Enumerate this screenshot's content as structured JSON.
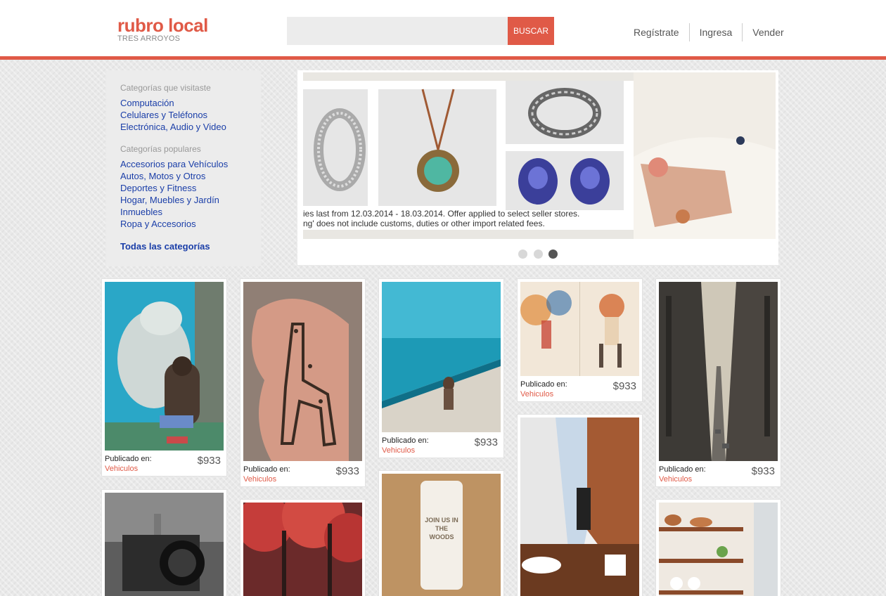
{
  "brand": {
    "title": "rubro local",
    "subtitle": "TRES ARROYOS",
    "accent": "#e05a47"
  },
  "search": {
    "placeholder": "",
    "button_label": "BUSCAR"
  },
  "nav": [
    {
      "label": "Regístrate"
    },
    {
      "label": "Ingresa"
    },
    {
      "label": "Vender"
    }
  ],
  "sidebar": {
    "visited_heading": "Categorías que visitaste",
    "visited": [
      "Computación",
      "Celulares y Teléfonos",
      "Electrónica, Audio y Video"
    ],
    "popular_heading": "Categorías populares",
    "popular": [
      "Accesorios para Vehículos",
      "Autos, Motos y Otros",
      "Deportes y Fitness",
      "Hogar, Muebles y Jardín",
      "Inmuebles",
      "Ropa y Accesorios"
    ],
    "all_label": "Todas las categorías"
  },
  "carousel": {
    "banner_line1": "ies last from 12.03.2014 - 18.03.2014. Offer applied to select seller stores.",
    "banner_line2": "ng' does not include customs, duties or other import related fees.",
    "slides": 3,
    "active_slide": 3
  },
  "products": [
    {
      "image": "polar-bear-image",
      "published_label": "Publicado en:",
      "category": "Vehiculos",
      "price": "$933"
    },
    {
      "image": "giraffe-hand-image",
      "published_label": "Publicado en:",
      "category": "Vehiculos",
      "price": "$933"
    },
    {
      "image": "pool-woman-image",
      "published_label": "Publicado en:",
      "category": "Vehiculos",
      "price": "$933"
    },
    {
      "image": "illustration-image",
      "published_label": "Publicado en:",
      "category": "Vehiculos",
      "price": "$933"
    },
    {
      "image": "city-street-image",
      "published_label": "Publicado en:",
      "category": "Vehiculos",
      "price": "$933"
    },
    {
      "image": "camera-house-image"
    },
    {
      "image": "red-forest-image"
    },
    {
      "image": "join-us-woods-image",
      "card_text": "JOIN US IN THE WOODS"
    },
    {
      "image": "bathroom-image"
    },
    {
      "image": "kitchen-shelves-image"
    }
  ]
}
